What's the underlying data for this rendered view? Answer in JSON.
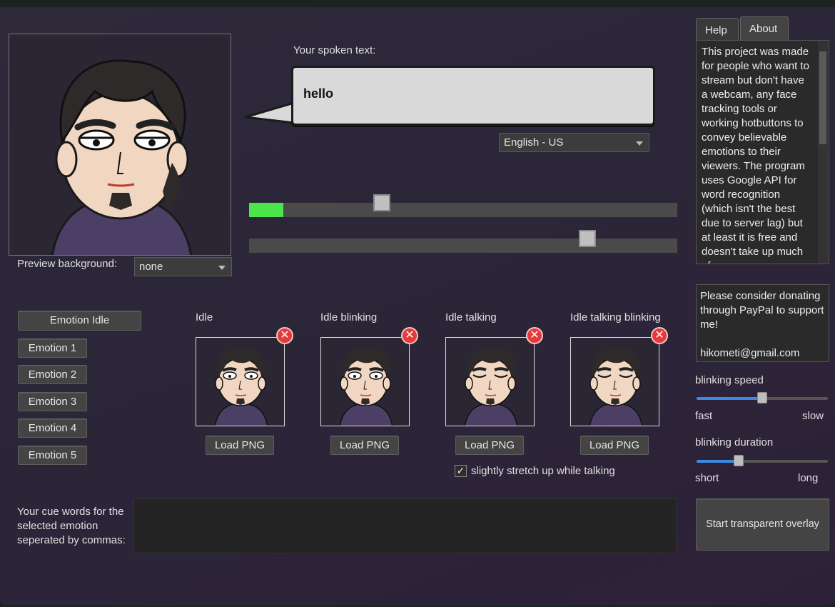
{
  "spoken_label": "Your spoken text:",
  "spoken_text": "hello",
  "language": "English - US",
  "mic_level": 0.08,
  "threshold_slider": 0.31,
  "sensitivity_slider": 0.79,
  "preview": {
    "label": "Preview background:",
    "value": "none"
  },
  "tabs": [
    "Help",
    "About"
  ],
  "about_text": "This project was made for people who want to stream but don't have a webcam, any face tracking tools or working hotbuttons to convey believable emotions to their viewers. The program uses Google API for word recognition (which isn't the best due to server lag) but at least it is free and doesn't take up much of your resources.",
  "donate_text_1": "Please consider donating through PayPal to support me!",
  "donate_email": "hikometi@gmail.com",
  "emotions": [
    "Emotion Idle",
    "Emotion 1",
    "Emotion 2",
    "Emotion 3",
    "Emotion 4",
    "Emotion 5"
  ],
  "slots": [
    {
      "title": "Idle",
      "button": "Load PNG",
      "eyes": "open"
    },
    {
      "title": "Idle blinking",
      "button": "Load PNG",
      "eyes": "open"
    },
    {
      "title": "Idle talking",
      "button": "Load PNG",
      "eyes": "closed"
    },
    {
      "title": "Idle talking blinking",
      "button": "Load PNG",
      "eyes": "closed"
    }
  ],
  "remove_glyph": "✕",
  "stretch_checkbox": {
    "label": "slightly stretch up while talking",
    "checked": true,
    "mark": "✓"
  },
  "blink_speed": {
    "label": "blinking speed",
    "min": "fast",
    "max": "slow",
    "value": 0.5
  },
  "blink_duration": {
    "label": "blinking duration",
    "min": "short",
    "max": "long",
    "value": 0.32
  },
  "overlay_button": "Start transparent overlay",
  "cue": {
    "label_lines": [
      "Your cue words for the",
      "selected emotion",
      "seperated by commas:"
    ],
    "value": ""
  },
  "colors": {
    "accent": "#3b8be6",
    "level": "#4ce64c",
    "remove": "#e63a3a"
  }
}
